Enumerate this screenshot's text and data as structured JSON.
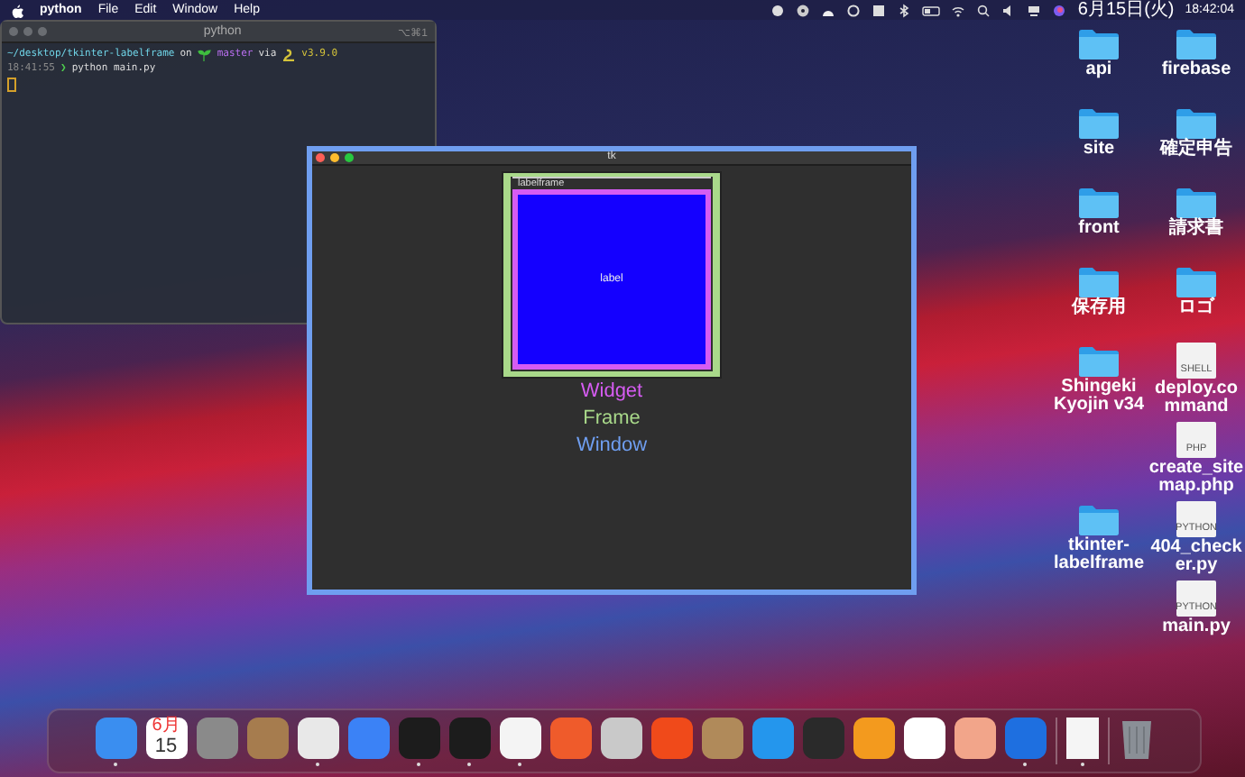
{
  "menu_bar": {
    "app": "python",
    "menus": [
      "File",
      "Edit",
      "Window",
      "Help"
    ],
    "date": "6月15日(火)",
    "time": "18:42:04"
  },
  "terminal": {
    "title": "python",
    "shortcut": "⌥⌘1",
    "path": "~/desktop/tkinter-labelframe",
    "on": "on",
    "branch": "master",
    "via": "via",
    "version": "v3.9.0",
    "clock": "18:41:55",
    "prompt": "❯",
    "command": "python main.py"
  },
  "tk_window": {
    "title": "tk",
    "labelframe": {
      "title": "labelframe",
      "label": "label"
    },
    "legend": [
      {
        "text": "Widget",
        "color": "#d65cf2"
      },
      {
        "text": "Frame",
        "color": "#a9d98a"
      },
      {
        "text": "Window",
        "color": "#6f9ef0"
      }
    ]
  },
  "desktop_icon_rows": [
    [
      {
        "label": "api",
        "kind": "folder"
      },
      {
        "label": "firebase",
        "kind": "folder"
      }
    ],
    [
      {
        "label": "site",
        "kind": "folder"
      },
      {
        "label": "確定申告",
        "kind": "folder"
      }
    ],
    [
      {
        "label": "front",
        "kind": "folder"
      },
      {
        "label": "請求書",
        "kind": "folder"
      }
    ],
    [
      {
        "label": "保存用",
        "kind": "folder"
      },
      {
        "label": "ロゴ",
        "kind": "folder"
      }
    ],
    [
      {
        "label": "Shingeki Kyojin v34",
        "kind": "folder"
      },
      {
        "label": "deploy.command",
        "kind": "file",
        "badge": "SHELL"
      }
    ],
    [
      {
        "label": "create_sitemap.php",
        "kind": "file",
        "badge": "PHP"
      }
    ],
    [
      {
        "label": "tkinter-labelframe",
        "kind": "folder"
      },
      {
        "label": "404_checker.py",
        "kind": "file",
        "badge": "PYTHON"
      }
    ],
    [
      {
        "label": "main.py",
        "kind": "file",
        "badge": "PYTHON"
      }
    ]
  ],
  "dock": [
    {
      "kind": "app",
      "color": "#3a8ef0",
      "running": true
    },
    {
      "kind": "calendar",
      "month": "6月",
      "day": "15",
      "running": false
    },
    {
      "kind": "app",
      "color": "#8a8a8a",
      "running": false
    },
    {
      "kind": "app",
      "color": "#a67c4e",
      "running": false
    },
    {
      "kind": "app",
      "color": "#e8e8e8",
      "running": true
    },
    {
      "kind": "app",
      "color": "#3b82f6",
      "running": false
    },
    {
      "kind": "app",
      "color": "#1c1c1c",
      "running": true
    },
    {
      "kind": "app",
      "color": "#1c1c1c",
      "running": true
    },
    {
      "kind": "app",
      "color": "#f4f4f4",
      "running": true
    },
    {
      "kind": "app",
      "color": "#ef5b2b",
      "running": false
    },
    {
      "kind": "app",
      "color": "#c9c9c9",
      "running": false
    },
    {
      "kind": "app",
      "color": "#f04a1a",
      "running": false
    },
    {
      "kind": "app",
      "color": "#b08a5a",
      "running": false
    },
    {
      "kind": "app",
      "color": "#2496ed",
      "running": false
    },
    {
      "kind": "app",
      "color": "#2a2a2a",
      "running": false
    },
    {
      "kind": "app",
      "color": "#f39a1e",
      "running": false
    },
    {
      "kind": "app",
      "color": "#ffffff",
      "running": false
    },
    {
      "kind": "app",
      "color": "#f2a58a",
      "running": false
    },
    {
      "kind": "app",
      "color": "#1e6fe0",
      "running": true
    },
    {
      "kind": "separator"
    },
    {
      "kind": "document",
      "running": true
    },
    {
      "kind": "separator"
    },
    {
      "kind": "trash",
      "running": false
    }
  ]
}
